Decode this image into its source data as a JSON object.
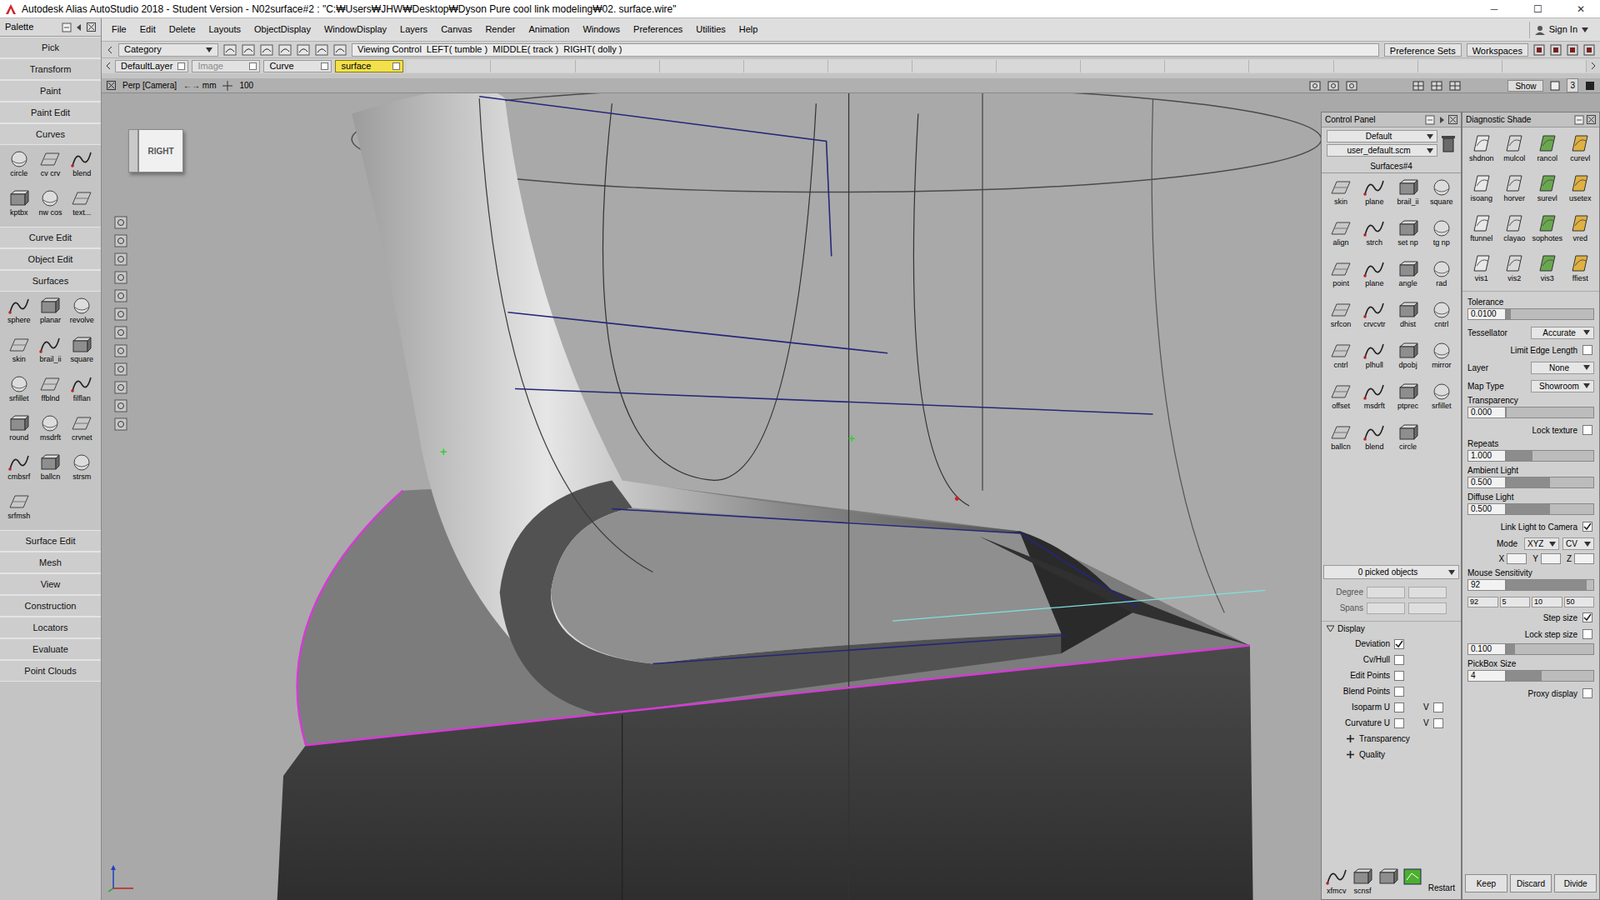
{
  "window": {
    "title": "Autodesk Alias AutoStudio 2018 - Student Version - N02surface#2 : \"C:₩Users₩JHW₩Desktop₩Dyson Pure cool link modeling₩02. surface.wire\"",
    "controls": [
      "─",
      "☐",
      "✕"
    ]
  },
  "menu": [
    "File",
    "Edit",
    "Delete",
    "Layouts",
    "ObjectDisplay",
    "WindowDisplay",
    "Layers",
    "Canvas",
    "Render",
    "Animation",
    "Windows",
    "Preferences",
    "Utilities",
    "Help"
  ],
  "sign_in": "Sign In",
  "palette": {
    "title": "Palette",
    "items": [
      {
        "kind": "button",
        "label": "Pick"
      },
      {
        "kind": "button",
        "label": "Transform"
      },
      {
        "kind": "button",
        "label": "Paint"
      },
      {
        "kind": "button",
        "label": "Paint Edit"
      },
      {
        "kind": "button",
        "label": "Curves"
      },
      {
        "kind": "tools",
        "tools": [
          "circle",
          "cv crv",
          "blend",
          "kptbx",
          "nw cos",
          "text..."
        ]
      },
      {
        "kind": "button",
        "label": "Curve Edit"
      },
      {
        "kind": "button",
        "label": "Object Edit"
      },
      {
        "kind": "button",
        "label": "Surfaces"
      },
      {
        "kind": "tools",
        "tools": [
          "sphere",
          "planar",
          "revolve",
          "skin",
          "brail_ii",
          "square",
          "srfillet",
          "ffblnd",
          "filflan",
          "round",
          "msdrft",
          "crvnet",
          "cmbsrf",
          "ballcn",
          "strsm",
          "srfmsh"
        ]
      },
      {
        "kind": "button",
        "label": "Surface Edit"
      },
      {
        "kind": "button",
        "label": "Mesh"
      },
      {
        "kind": "button",
        "label": "View"
      },
      {
        "kind": "button",
        "label": "Construction"
      },
      {
        "kind": "button",
        "label": "Locators"
      },
      {
        "kind": "button",
        "label": "Evaluate"
      },
      {
        "kind": "button",
        "label": "Point Clouds"
      }
    ]
  },
  "shelf": {
    "category": "Category",
    "viewing_control": "Viewing Control",
    "hints": "LEFT( tumble )  MIDDLE( track )  RIGHT( dolly )",
    "preference_sets": "Preference Sets",
    "workspaces": "Workspaces"
  },
  "layers": [
    {
      "label": "DefaultLayer",
      "selected": false,
      "disabled": false
    },
    {
      "label": "Image",
      "selected": false,
      "disabled": true
    },
    {
      "label": "Curve",
      "selected": false,
      "disabled": false
    },
    {
      "label": "surface",
      "selected": true,
      "disabled": false
    }
  ],
  "viewport": {
    "camera": "Perp [Camera]",
    "units": "←→ mm",
    "scale": "100",
    "view_cube": "RIGHT",
    "show": "Show",
    "count": "3"
  },
  "control_panel": {
    "title": "Control Panel",
    "preset": "Default",
    "scheme": "user_default.scm",
    "shelf": "Surfaces#4",
    "tools": [
      "skin",
      "plane",
      "brail_ii",
      "square",
      "align",
      "strch",
      "set np",
      "tg np",
      "point",
      "plane",
      "angle",
      "rad",
      "srfcon",
      "crvcvtr",
      "dhist",
      "cntrl",
      "cntrl",
      "plhull",
      "dpobj",
      "mirror",
      "offset",
      "msdrft",
      "ptprec",
      "srfillet",
      "ballcn",
      "blend",
      "circle"
    ],
    "picked": "0 picked objects",
    "fields": [
      "Degree",
      "Spans"
    ],
    "display": {
      "title": "Display",
      "expanded": true,
      "items": [
        {
          "kind": "single",
          "label": "Deviation",
          "checked": true
        },
        {
          "kind": "single",
          "label": "Cv/Hull",
          "checked": false
        },
        {
          "kind": "single",
          "label": "Edit Points",
          "checked": false
        },
        {
          "kind": "single",
          "label": "Blend Points",
          "checked": false
        },
        {
          "kind": "pair",
          "label": "Isoparm U",
          "checked": false,
          "v_label": "V",
          "v_checked": false
        },
        {
          "kind": "pair",
          "label": "Curvature U",
          "checked": false,
          "v_label": "V",
          "v_checked": false
        }
      ]
    },
    "more": [
      {
        "label": "Transparency",
        "expanded": false
      },
      {
        "label": "Quality",
        "expanded": false
      }
    ],
    "bottom_tools": [
      "xfmcv",
      "scnsf"
    ],
    "restart": "Restart"
  },
  "diagnostic": {
    "title": "Diagnostic Shade",
    "tools": [
      "shdnon",
      "mulcol",
      "rancol",
      "curevl",
      "isoang",
      "horver",
      "surevl",
      "usetex",
      "ftunnel",
      "clayao",
      "sophotes",
      "vred",
      "vis1",
      "vis2",
      "vis3",
      "ffiest"
    ],
    "settings": [
      {
        "kind": "slider",
        "label": "Tolerance",
        "value": "0.0100",
        "level": 0.05
      },
      {
        "kind": "select",
        "label": "Tessellator",
        "value": "Accurate"
      },
      {
        "kind": "check",
        "label": "Limit Edge Length",
        "checked": false
      },
      {
        "kind": "select",
        "label": "Layer",
        "value": "None"
      },
      {
        "kind": "select",
        "label": "Map Type",
        "value": "Showroom"
      },
      {
        "kind": "slider",
        "label": "Transparency",
        "value": "0.000",
        "level": 0
      },
      {
        "kind": "check",
        "label": "Lock texture",
        "checked": false
      },
      {
        "kind": "slider",
        "label": "Repeats",
        "value": "1.000",
        "level": 0.3
      },
      {
        "kind": "slider",
        "label": "Ambient Light",
        "value": "0.500",
        "level": 0.5
      },
      {
        "kind": "slider",
        "label": "Diffuse Light",
        "value": "0.500",
        "level": 0.5
      },
      {
        "kind": "check",
        "label": "Link Light to Camera",
        "checked": true
      },
      {
        "kind": "mode",
        "label": "Mode",
        "value": "XYZ",
        "value2": "CV",
        "axes": [
          "X",
          "Y",
          "Z"
        ]
      },
      {
        "kind": "slider",
        "label": "Mouse Sensitivity",
        "value": "92",
        "level": 0.92
      },
      {
        "kind": "numbers",
        "values": [
          "92",
          "5",
          "10",
          "50"
        ]
      },
      {
        "kind": "check",
        "label": "Step size",
        "checked": true
      },
      {
        "kind": "check",
        "label": "Lock step size",
        "checked": false
      },
      {
        "kind": "slider",
        "value": "0.100",
        "level": 0.1
      },
      {
        "kind": "slider",
        "label": "PickBox Size",
        "value": "4",
        "level": 0.4
      },
      {
        "kind": "check",
        "label": "Proxy display",
        "checked": false
      }
    ],
    "buttons": [
      "Keep",
      "Discard",
      "Divide"
    ]
  }
}
